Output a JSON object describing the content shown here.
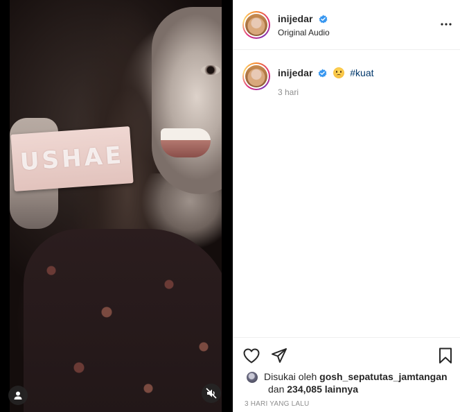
{
  "post": {
    "username": "inijedar",
    "audio_label": "Original Audio",
    "product_text": "USHAE"
  },
  "caption": {
    "username": "inijedar",
    "emoji": "disappointed-face-emoji",
    "hashtag": "#kuat",
    "time_ago": "3 hari"
  },
  "likes": {
    "prefix": "Disukai oleh",
    "liker": "gosh_sepatutas_jamtangan",
    "and_label": "dan",
    "others_count": "234,085",
    "others_label": "lainnya"
  },
  "posted_date": "3 HARI YANG LALU",
  "icons": {
    "verified": "verified-badge-icon",
    "more": "more-options-icon",
    "like": "heart-icon",
    "share": "paper-plane-icon",
    "save": "bookmark-icon",
    "tagged_user": "user-icon",
    "mute": "muted-speaker-icon"
  },
  "colors": {
    "verified_blue": "#3897f0",
    "hashtag": "#00376b",
    "secondary_text": "#8e8e8e",
    "primary_text": "#262626"
  }
}
